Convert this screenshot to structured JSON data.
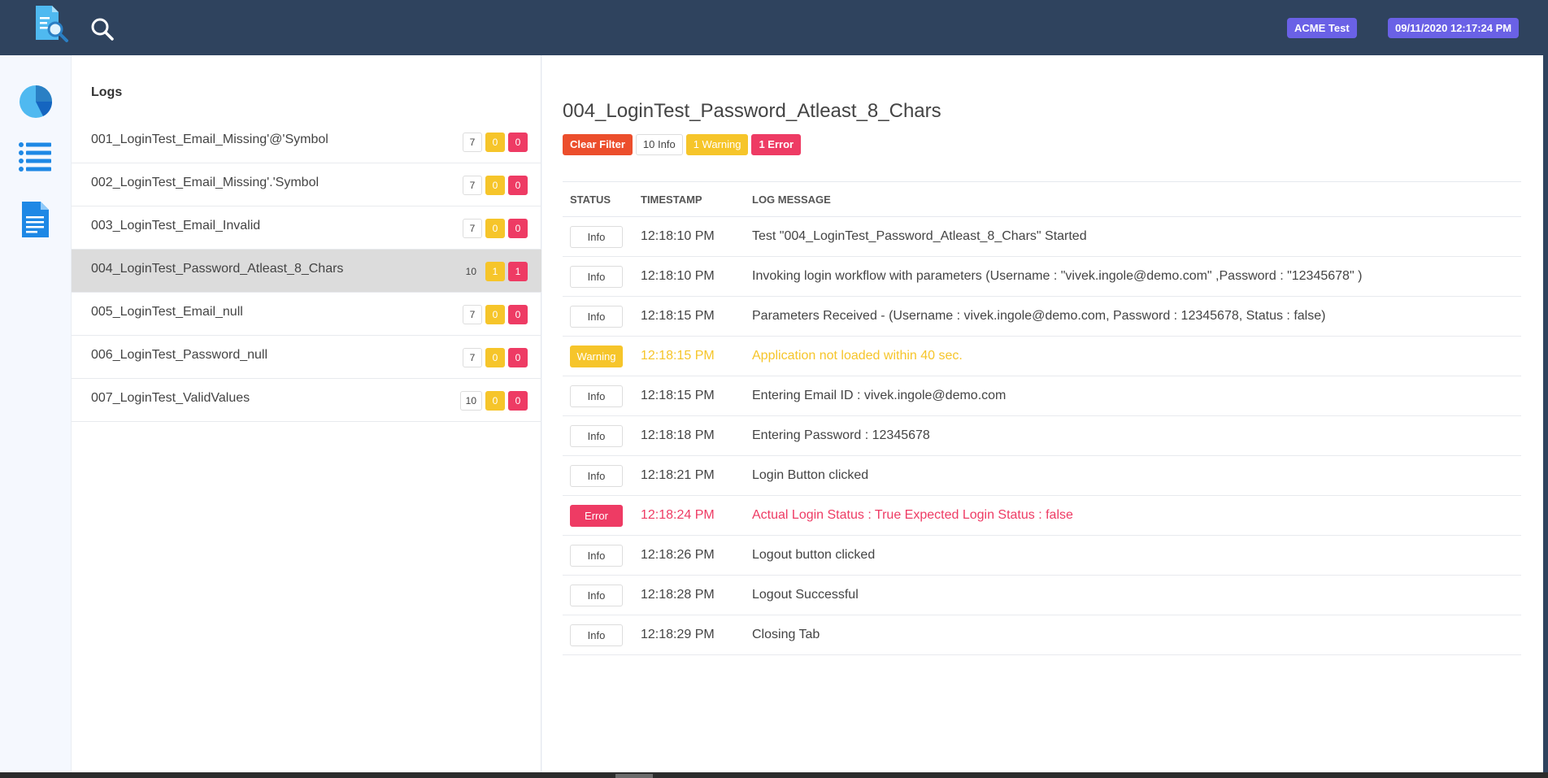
{
  "header": {
    "project_name": "ACME Test",
    "datetime": "09/11/2020 12:17:24 PM",
    "logo_icon": "report-search-icon",
    "search_icon": "search-icon"
  },
  "nav": {
    "items": [
      {
        "name": "dashboard",
        "icon": "pie-chart-icon"
      },
      {
        "name": "tests",
        "icon": "list-icon"
      },
      {
        "name": "logs",
        "icon": "document-icon"
      }
    ]
  },
  "list": {
    "title": "Logs",
    "tests": [
      {
        "name": "001_LoginTest_Email_Missing'@'Symbol",
        "info": "7",
        "warning": "0",
        "error": "0"
      },
      {
        "name": "002_LoginTest_Email_Missing'.'Symbol",
        "info": "7",
        "warning": "0",
        "error": "0"
      },
      {
        "name": "003_LoginTest_Email_Invalid",
        "info": "7",
        "warning": "0",
        "error": "0"
      },
      {
        "name": "004_LoginTest_Password_Atleast_8_Chars",
        "info": "10",
        "warning": "1",
        "error": "1"
      },
      {
        "name": "005_LoginTest_Email_null",
        "info": "7",
        "warning": "0",
        "error": "0"
      },
      {
        "name": "006_LoginTest_Password_null",
        "info": "7",
        "warning": "0",
        "error": "0"
      },
      {
        "name": "007_LoginTest_ValidValues",
        "info": "10",
        "warning": "0",
        "error": "0"
      }
    ],
    "selected_index": 3
  },
  "detail": {
    "title": "004_LoginTest_Password_Atleast_8_Chars",
    "filters": {
      "clear": "Clear Filter",
      "info": "10 Info",
      "warning": "1 Warning",
      "error": "1 Error"
    },
    "columns": [
      "STATUS",
      "TIMESTAMP",
      "LOG MESSAGE"
    ],
    "logs": [
      {
        "status": "Info",
        "time": "12:18:10 PM",
        "message": "Test \"004_LoginTest_Password_Atleast_8_Chars\" Started"
      },
      {
        "status": "Info",
        "time": "12:18:10 PM",
        "message": "Invoking login workflow with parameters (Username : \"vivek.ingole@demo.com\" ,Password : \"12345678\" )"
      },
      {
        "status": "Info",
        "time": "12:18:15 PM",
        "message": "Parameters Received - (Username : vivek.ingole@demo.com, Password : 12345678, Status : false)"
      },
      {
        "status": "Warning",
        "time": "12:18:15 PM",
        "message": "Application not loaded within 40 sec."
      },
      {
        "status": "Info",
        "time": "12:18:15 PM",
        "message": "Entering Email ID : vivek.ingole@demo.com"
      },
      {
        "status": "Info",
        "time": "12:18:18 PM",
        "message": "Entering Password : 12345678"
      },
      {
        "status": "Info",
        "time": "12:18:21 PM",
        "message": "Login Button clicked"
      },
      {
        "status": "Error",
        "time": "12:18:24 PM",
        "message": "Actual Login Status : True Expected Login Status : false"
      },
      {
        "status": "Info",
        "time": "12:18:26 PM",
        "message": "Logout button clicked"
      },
      {
        "status": "Info",
        "time": "12:18:28 PM",
        "message": "Logout Successful"
      },
      {
        "status": "Info",
        "time": "12:18:29 PM",
        "message": "Closing Tab"
      }
    ]
  },
  "colors": {
    "topbar": "#2f435e",
    "pill": "#6a61e6",
    "warning": "#f6c52a",
    "error": "#ee3b64",
    "clear_filter": "#ec4e2c",
    "selected_row": "#dcdcdc"
  }
}
